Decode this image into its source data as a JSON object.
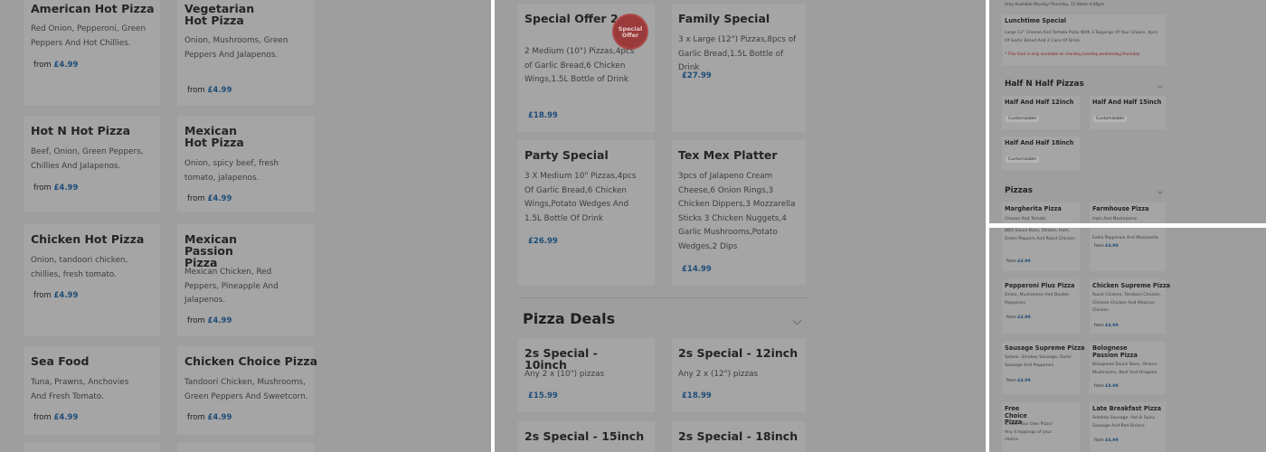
{
  "panel1": {
    "from_label": "from",
    "items": [
      {
        "title": "American Hot Pizza",
        "desc": "Red Onion, Pepperoni, Green Peppers And Hot Chillies.",
        "price": "£4.99"
      },
      {
        "title": "Vegetarian Hot Pizza",
        "desc": "Onion, Mushrooms, Green Peppers And Jalapenos.",
        "price": "£4.99"
      },
      {
        "title": "Hot N Hot Pizza",
        "desc": "Beef, Onion, Green Peppers, Chillies And Jalapenos.",
        "price": "£4.99"
      },
      {
        "title": "Mexican Hot Pizza",
        "desc": "Onion, spicy beef, fresh tomato, jalapenos.",
        "price": "£4.99"
      },
      {
        "title": "Chicken Hot Pizza",
        "desc": "Onion, tandoori chicken, chillies, fresh tomato.",
        "price": "£4.99"
      },
      {
        "title": "Mexican Passion Pizza",
        "desc": "Mexican Chicken, Red Peppers, Pineapple And Jalapenos.",
        "price": "£4.99"
      },
      {
        "title": "Sea Food",
        "desc": "Tuna, Prawns, Anchovies And Fresh Tomato.",
        "price": "£4.99"
      },
      {
        "title": "Chicken Choice Pizza",
        "desc": "Tandoori Chicken, Mushrooms, Green Peppers And Sweetcorn.",
        "price": "£4.99"
      }
    ]
  },
  "panel2": {
    "offer_badge": "Special Offer",
    "items": [
      {
        "title": "Special Offer 2",
        "desc": "2 Medium (10\") Pizzas,4pcs of Garlic Bread,6 Chicken Wings,1.5L Bottle of Drink",
        "price": "£18.99"
      },
      {
        "title": "Family Special",
        "desc": "3 x Large (12\") Pizzas,8pcs of Garlic Bread,1.5L Bottle of Drink",
        "price": "£27.99"
      },
      {
        "title": "Party Special",
        "desc": "3 X Medium 10\" Pizzas,4pcs Of Garlic Bread,6 Chicken Wings,Potato Wedges And 1.5L Bottle Of Drink",
        "price": "£26.99"
      },
      {
        "title": "Tex Mex Platter",
        "desc": "3pcs of Jalapeno Cream Cheese,6 Onion Rings,3 Chicken Dippers,3 Mozzarella Sticks 3 Chicken Nuggets,4 Garlic Mushrooms,Potato Wedges,2 Dips",
        "price": "£14.99"
      }
    ],
    "section_title": "Pizza Deals",
    "deals": [
      {
        "title": "2s Special - 10inch",
        "desc": "Any 2 x (10\") pizzas",
        "price": "£15.99"
      },
      {
        "title": "2s Special - 12inch",
        "desc": "Any 2 x (12\") pizzas",
        "price": "£18.99"
      },
      {
        "title": "2s Special - 15inch",
        "desc": "",
        "price": ""
      },
      {
        "title": "2s Special - 18inch",
        "desc": "",
        "price": ""
      }
    ]
  },
  "panel3": {
    "availability": "Only Available Monday-Thursday, 11:00am-4:00pm",
    "lunch_title": "Lunchtime Special",
    "lunch_desc": "Large 12\" Cheese And Tomato Pizza With 3 Toppings Of Your Choice, 4pcs Of Garlic Bread And 2 Cans Of Drink",
    "lunch_note": "* This food is only available on monday,tuesday,wednesday,thursday",
    "half_section": "Half N Half Pizzas",
    "customizable": "Customizable",
    "half_items": [
      "Half And Half 12inch",
      "Half And Half 15inch",
      "Half And Half 18inch"
    ],
    "pizzas_section": "Pizzas",
    "pizza_items": [
      {
        "title": "Margherita Pizza",
        "desc": "Cheese And Tomato"
      },
      {
        "title": "Farmhouse Pizza",
        "desc": "Ham And Mushrooms"
      }
    ]
  },
  "panel4": {
    "from_label": "from",
    "top_items": [
      {
        "desc": "BBQ Sauce Base, Onions, Ham, Green Peppers And Roast Chicken.",
        "price": "£4.99"
      },
      {
        "desc": "Extra Pepperoni And Mozzarella",
        "price": "£4.99"
      }
    ],
    "items": [
      {
        "title": "Pepperoni Plus Pizza",
        "desc": "Onion, Mushrooms And Double Pepperoni",
        "price": "£4.99"
      },
      {
        "title": "Chicken Supreme Pizza",
        "desc": "Roast Chicken, Tandoori Chicken, Chinese Chicken And Mexican Chicken",
        "price": "£4.99"
      },
      {
        "title": "Sausage Supreme Pizza",
        "desc": "Salami, Smokey Sausage, Garlic Sausage And Pepperoni",
        "price": "£4.99"
      },
      {
        "title": "Bolognese Passion Pizza",
        "desc": "Bolognese Sauce Base, Onions, Mushrooms, Beef And Oregano.",
        "price": "£4.99"
      },
      {
        "title": "Free Choice Pizza",
        "desc": "Create Your Own Pizza! Any 4 toppings of your choice.",
        "price": ""
      },
      {
        "title": "Late Breakfast Pizza",
        "desc": "Smokey Sausage, Hot & Spicy Sausage And Red Onions",
        "price": "£4.99"
      }
    ]
  }
}
